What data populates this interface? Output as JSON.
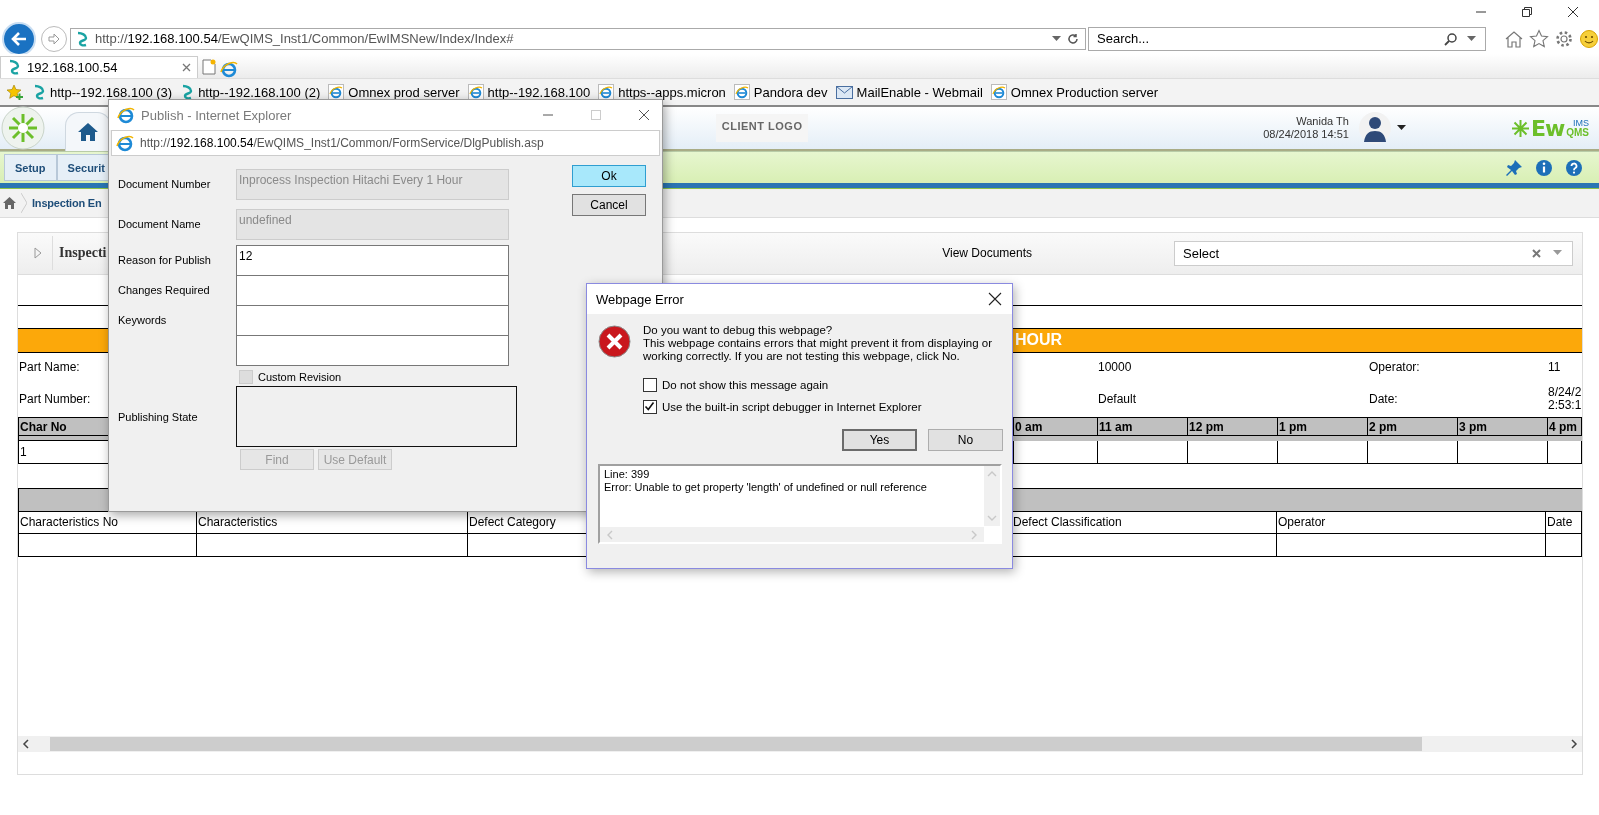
{
  "browser": {
    "address": {
      "scheme": "http://",
      "host": "192.168.100.54",
      "path": "/EwQIMS_Inst1/Common/EwIMSNew/Index/Index#"
    },
    "search": {
      "placeholder": "Search..."
    },
    "tabs": [
      {
        "label": "192.168.100.54",
        "selected": true
      }
    ],
    "favorites": [
      {
        "label": "http--192.168.100 (3)",
        "kind": "site"
      },
      {
        "label": "http--192.168.100 (2)",
        "kind": "site"
      },
      {
        "label": "Omnex prod server",
        "kind": "browser"
      },
      {
        "label": "http--192.168.100",
        "kind": "browser"
      },
      {
        "label": "https--apps.micron",
        "kind": "browser"
      },
      {
        "label": "Pandora dev",
        "kind": "browser"
      },
      {
        "label": "MailEnable - Webmail",
        "kind": "mail"
      },
      {
        "label": "Omnex Production server",
        "kind": "browser"
      }
    ]
  },
  "app": {
    "client_logo": "CLIENT LOGO",
    "user": {
      "name": "Wanida Th",
      "datetime": "08/24/2018 14:51"
    },
    "brand": {
      "main": "Ew",
      "top": "IMS",
      "bottom": "QMS"
    },
    "nav_tabs": [
      {
        "label": "Setup"
      },
      {
        "label": "Securit"
      }
    ],
    "breadcrumb": "Inspection En"
  },
  "panel": {
    "title": "Inspecti",
    "view_documents_label": "View Documents",
    "documents_select": {
      "value": "Select"
    }
  },
  "form_banner": "HOUR",
  "info_rows": [
    {
      "cells": [
        "Part Name:",
        "10000",
        "Operator:",
        "11"
      ]
    },
    {
      "cells": [
        "Part Number:",
        "Default",
        "Date:",
        "8/24/2\n2:53:1"
      ]
    }
  ],
  "hour_table": {
    "columns": [
      "Char No",
      "0 am",
      "11 am",
      "12 pm",
      "1 pm",
      "2 pm",
      "3 pm",
      "4 pm"
    ],
    "rows": [
      {
        "char_no": "1"
      }
    ]
  },
  "defect_table": {
    "columns": [
      "Characteristics No",
      "Characteristics",
      "Defect Category",
      "Defect Classification",
      "Operator",
      "Date"
    ]
  },
  "publish_dialog": {
    "title": "Publish - Internet Explorer",
    "url": {
      "scheme": "http://",
      "host": "192.168.100.54",
      "path": "/EwQIMS_Inst1/Common/FormService/DlgPublish.asp"
    },
    "fields": [
      {
        "label": "Document Number",
        "value": "Inprocess Inspection Hitachi Every 1 Hour",
        "disabled": true
      },
      {
        "label": "Document Name",
        "value": "undefined",
        "disabled": true
      },
      {
        "label": "Reason for Publish",
        "value": "12",
        "disabled": false
      },
      {
        "label": "Changes Required",
        "disabled": false
      },
      {
        "label": "Keywords",
        "disabled": false
      },
      {
        "disabled": false
      }
    ],
    "custom_revision": {
      "label": "Custom Revision",
      "checked": false,
      "disabled": true
    },
    "publishing_state": {
      "label": "Publishing State"
    },
    "buttons": [
      {
        "label": "Find",
        "disabled": true
      },
      {
        "label": "Use Default",
        "disabled": true
      }
    ],
    "actions": [
      {
        "label": "Ok",
        "focused": true
      },
      {
        "label": "Cancel",
        "focused": false
      }
    ]
  },
  "error_dialog": {
    "title": "Webpage Error",
    "question": "Do you want to debug this webpage?",
    "message": "This webpage contains errors that might prevent it from displaying or working correctly. If you are not testing this webpage, click No.",
    "options": [
      {
        "label": "Do not show this message again",
        "checked": false
      },
      {
        "label": "Use the built-in script debugger in Internet Explorer",
        "checked": true
      }
    ],
    "buttons": [
      {
        "label": "Yes",
        "default": true
      },
      {
        "label": "No",
        "default": false
      }
    ],
    "details": [
      "Line: 399",
      "Error: Unable to get property 'length' of undefined or null reference"
    ]
  }
}
